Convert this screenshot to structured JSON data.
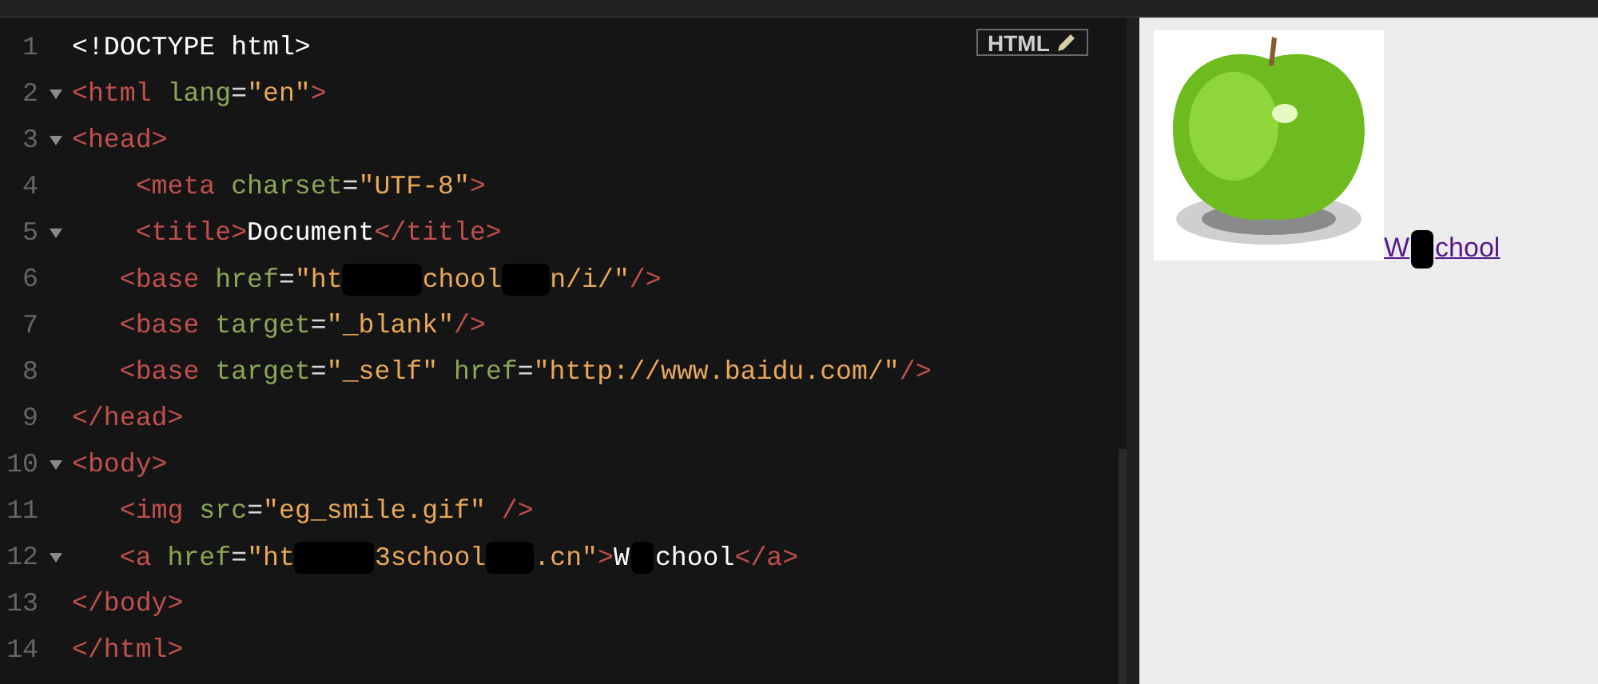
{
  "editor": {
    "mode_button": "HTML",
    "lines": [
      {
        "number": "1",
        "tokens": [
          {
            "kind": "text",
            "text": "<!DOCTYPE html>"
          }
        ]
      },
      {
        "number": "2",
        "expanded": true,
        "tokens": [
          {
            "kind": "tag",
            "text": "<html"
          },
          {
            "kind": "attr",
            "text": " lang"
          },
          {
            "kind": "punct",
            "text": "="
          },
          {
            "kind": "str",
            "text": "\"en\""
          },
          {
            "kind": "tag",
            "text": ">"
          }
        ]
      },
      {
        "number": "3",
        "expanded": true,
        "tokens": [
          {
            "kind": "tag",
            "text": "<head>"
          }
        ]
      },
      {
        "number": "4",
        "tokens": [
          {
            "kind": "tag",
            "text": "    <meta"
          },
          {
            "kind": "attr",
            "text": " charset"
          },
          {
            "kind": "punct",
            "text": "="
          },
          {
            "kind": "str",
            "text": "\"UTF-8\""
          },
          {
            "kind": "tag",
            "text": ">"
          }
        ]
      },
      {
        "number": "5",
        "expanded": true,
        "tokens": [
          {
            "kind": "tag",
            "text": "    <title>"
          },
          {
            "kind": "text",
            "text": "Document"
          },
          {
            "kind": "tag",
            "text": "</title>"
          }
        ]
      },
      {
        "number": "6",
        "tokens": [
          {
            "kind": "tag",
            "text": "   <base"
          },
          {
            "kind": "attr",
            "text": " href"
          },
          {
            "kind": "punct",
            "text": "="
          },
          {
            "kind": "str",
            "text": "\"ht"
          },
          {
            "kind": "redact-long"
          },
          {
            "kind": "str",
            "text": "chool"
          },
          {
            "kind": "redact-short"
          },
          {
            "kind": "str",
            "text": "n/i/\""
          },
          {
            "kind": "tag",
            "text": "/>"
          }
        ]
      },
      {
        "number": "7",
        "tokens": [
          {
            "kind": "tag",
            "text": "   <base"
          },
          {
            "kind": "attr",
            "text": " target"
          },
          {
            "kind": "punct",
            "text": "="
          },
          {
            "kind": "str",
            "text": "\"_blank\""
          },
          {
            "kind": "tag",
            "text": "/>"
          }
        ]
      },
      {
        "number": "8",
        "tokens": [
          {
            "kind": "tag",
            "text": "   <base"
          },
          {
            "kind": "attr",
            "text": " target"
          },
          {
            "kind": "punct",
            "text": "="
          },
          {
            "kind": "str",
            "text": "\"_self\""
          },
          {
            "kind": "attr",
            "text": " href"
          },
          {
            "kind": "punct",
            "text": "="
          },
          {
            "kind": "str",
            "text": "\"http://www.baidu.com/\""
          },
          {
            "kind": "tag",
            "text": "/>"
          }
        ]
      },
      {
        "number": "9",
        "tokens": [
          {
            "kind": "tag",
            "text": "</head>"
          }
        ]
      },
      {
        "number": "10",
        "expanded": true,
        "tokens": [
          {
            "kind": "tag",
            "text": "<body>"
          }
        ]
      },
      {
        "number": "11",
        "tokens": [
          {
            "kind": "tag",
            "text": "   <img"
          },
          {
            "kind": "attr",
            "text": " src"
          },
          {
            "kind": "punct",
            "text": "="
          },
          {
            "kind": "str",
            "text": "\"eg_smile.gif\""
          },
          {
            "kind": "tag",
            "text": " />"
          }
        ]
      },
      {
        "number": "12",
        "expanded": true,
        "tokens": [
          {
            "kind": "tag",
            "text": "   <a"
          },
          {
            "kind": "attr",
            "text": " href"
          },
          {
            "kind": "punct",
            "text": "="
          },
          {
            "kind": "str",
            "text": "\"ht"
          },
          {
            "kind": "redact-long"
          },
          {
            "kind": "str",
            "text": "3school"
          },
          {
            "kind": "redact-short"
          },
          {
            "kind": "str",
            "text": ".cn\""
          },
          {
            "kind": "tag",
            "text": ">"
          },
          {
            "kind": "text",
            "text": "W"
          },
          {
            "kind": "redact-tiny"
          },
          {
            "kind": "text",
            "text": "chool"
          },
          {
            "kind": "tag",
            "text": "</a>"
          }
        ]
      },
      {
        "number": "13",
        "tokens": [
          {
            "kind": "tag",
            "text": "</body>"
          }
        ]
      },
      {
        "number": "14",
        "tokens": [
          {
            "kind": "tag",
            "text": "</html>"
          }
        ]
      }
    ]
  },
  "preview": {
    "link": [
      {
        "kind": "text",
        "text": "W"
      },
      {
        "kind": "redact-tiny"
      },
      {
        "kind": "text",
        "text": "chool"
      }
    ]
  }
}
